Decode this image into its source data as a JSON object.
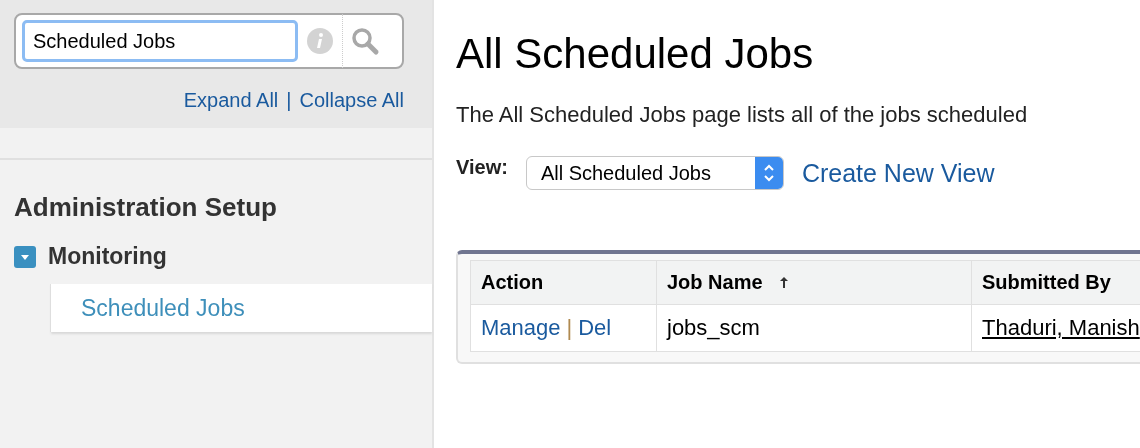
{
  "sidebar": {
    "search": {
      "value": "Scheduled Jobs"
    },
    "links": [
      {
        "label": "Expand All"
      },
      {
        "label": "Collapse All"
      }
    ],
    "link_separator": "|",
    "heading": "Administration Setup",
    "tree": [
      {
        "label": "Monitoring",
        "expanded": true,
        "children": [
          {
            "label": "Scheduled Jobs",
            "selected": true
          }
        ]
      }
    ]
  },
  "main": {
    "title": "All Scheduled Jobs",
    "description": "The All Scheduled Jobs page lists all of the jobs scheduled",
    "view": {
      "label": "View:",
      "value": "All Scheduled Jobs",
      "create_link": "Create New View"
    },
    "table": {
      "columns": [
        {
          "label": "Action",
          "sorted": false
        },
        {
          "label": "Job Name",
          "sorted": true
        },
        {
          "label": "Submitted By",
          "sorted": false
        }
      ],
      "rows": [
        {
          "actions": [
            "Manage",
            "Del"
          ],
          "action_separator": "|",
          "job_name": "jobs_scm",
          "submitted_by": "Thaduri, Manish"
        }
      ]
    }
  }
}
